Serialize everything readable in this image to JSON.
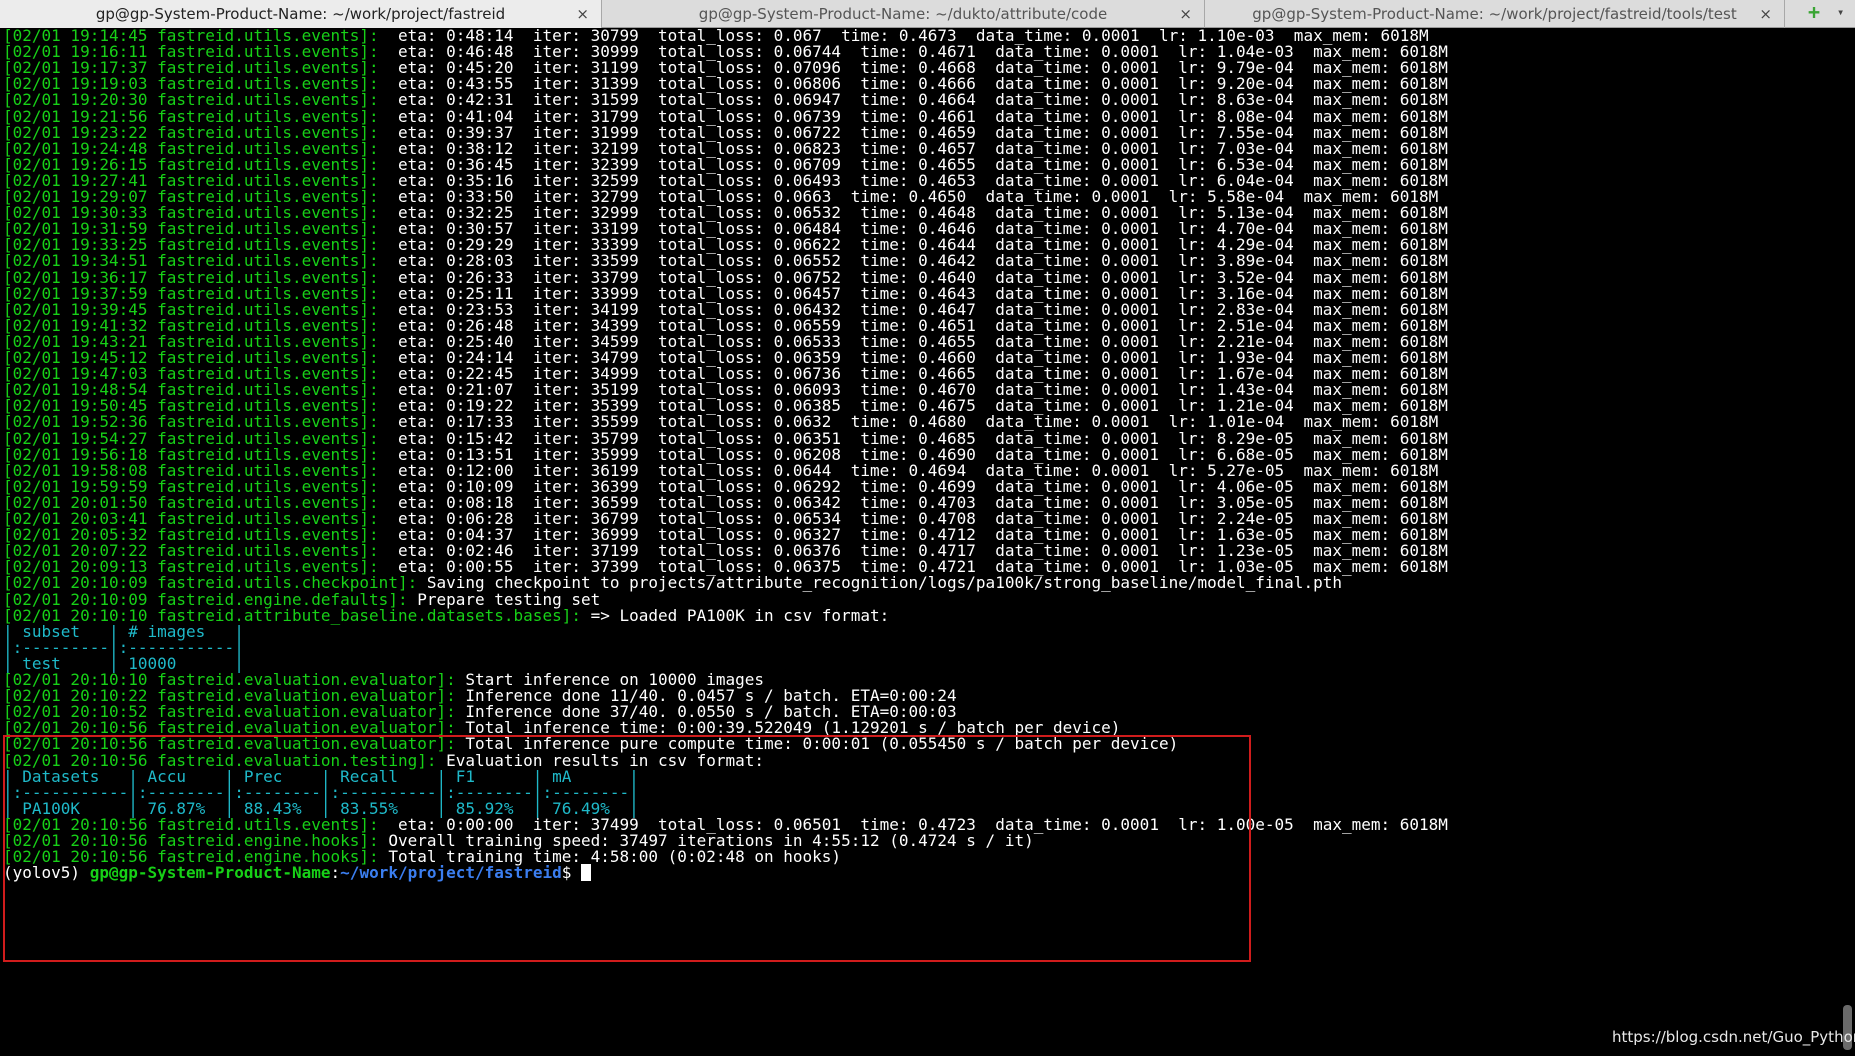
{
  "tabs": [
    {
      "title": "gp@gp-System-Product-Name: ~/work/project/fastreid",
      "active": true
    },
    {
      "title": "gp@gp-System-Product-Name: ~/dukto/attribute/code",
      "active": false
    },
    {
      "title": "gp@gp-System-Product-Name: ~/work/project/fastreid/tools/test",
      "active": false
    }
  ],
  "tab_close_symbol": "×",
  "new_tab_symbol": "+",
  "tab_menu_symbol": "▾",
  "colors": {
    "background": "#000000",
    "source_green": "#17d017",
    "table_cyan": "#1fb9c9",
    "highlight_red": "#d01c1c",
    "path_blue": "#3b7ef0"
  },
  "lines": [
    {
      "src": "[02/01 19:14:45 fastreid.utils.events]:",
      "msg": "  eta: 0:48:14  iter: 30799  total_loss: 0.067  time: 0.4673  data_time: 0.0001  lr: 1.10e-03  max_mem: 6018M"
    },
    {
      "src": "[02/01 19:16:11 fastreid.utils.events]:",
      "msg": "  eta: 0:46:48  iter: 30999  total_loss: 0.06744  time: 0.4671  data_time: 0.0001  lr: 1.04e-03  max_mem: 6018M"
    },
    {
      "src": "[02/01 19:17:37 fastreid.utils.events]:",
      "msg": "  eta: 0:45:20  iter: 31199  total_loss: 0.07096  time: 0.4668  data_time: 0.0001  lr: 9.79e-04  max_mem: 6018M"
    },
    {
      "src": "[02/01 19:19:03 fastreid.utils.events]:",
      "msg": "  eta: 0:43:55  iter: 31399  total_loss: 0.06806  time: 0.4666  data_time: 0.0001  lr: 9.20e-04  max_mem: 6018M"
    },
    {
      "src": "[02/01 19:20:30 fastreid.utils.events]:",
      "msg": "  eta: 0:42:31  iter: 31599  total_loss: 0.06947  time: 0.4664  data_time: 0.0001  lr: 8.63e-04  max_mem: 6018M"
    },
    {
      "src": "[02/01 19:21:56 fastreid.utils.events]:",
      "msg": "  eta: 0:41:04  iter: 31799  total_loss: 0.06739  time: 0.4661  data_time: 0.0001  lr: 8.08e-04  max_mem: 6018M"
    },
    {
      "src": "[02/01 19:23:22 fastreid.utils.events]:",
      "msg": "  eta: 0:39:37  iter: 31999  total_loss: 0.06722  time: 0.4659  data_time: 0.0001  lr: 7.55e-04  max_mem: 6018M"
    },
    {
      "src": "[02/01 19:24:48 fastreid.utils.events]:",
      "msg": "  eta: 0:38:12  iter: 32199  total_loss: 0.06823  time: 0.4657  data_time: 0.0001  lr: 7.03e-04  max_mem: 6018M"
    },
    {
      "src": "[02/01 19:26:15 fastreid.utils.events]:",
      "msg": "  eta: 0:36:45  iter: 32399  total_loss: 0.06709  time: 0.4655  data_time: 0.0001  lr: 6.53e-04  max_mem: 6018M"
    },
    {
      "src": "[02/01 19:27:41 fastreid.utils.events]:",
      "msg": "  eta: 0:35:16  iter: 32599  total_loss: 0.06493  time: 0.4653  data_time: 0.0001  lr: 6.04e-04  max_mem: 6018M"
    },
    {
      "src": "[02/01 19:29:07 fastreid.utils.events]:",
      "msg": "  eta: 0:33:50  iter: 32799  total_loss: 0.0663  time: 0.4650  data_time: 0.0001  lr: 5.58e-04  max_mem: 6018M"
    },
    {
      "src": "[02/01 19:30:33 fastreid.utils.events]:",
      "msg": "  eta: 0:32:25  iter: 32999  total_loss: 0.06532  time: 0.4648  data_time: 0.0001  lr: 5.13e-04  max_mem: 6018M"
    },
    {
      "src": "[02/01 19:31:59 fastreid.utils.events]:",
      "msg": "  eta: 0:30:57  iter: 33199  total_loss: 0.06484  time: 0.4646  data_time: 0.0001  lr: 4.70e-04  max_mem: 6018M"
    },
    {
      "src": "[02/01 19:33:25 fastreid.utils.events]:",
      "msg": "  eta: 0:29:29  iter: 33399  total_loss: 0.06622  time: 0.4644  data_time: 0.0001  lr: 4.29e-04  max_mem: 6018M"
    },
    {
      "src": "[02/01 19:34:51 fastreid.utils.events]:",
      "msg": "  eta: 0:28:03  iter: 33599  total_loss: 0.06552  time: 0.4642  data_time: 0.0001  lr: 3.89e-04  max_mem: 6018M"
    },
    {
      "src": "[02/01 19:36:17 fastreid.utils.events]:",
      "msg": "  eta: 0:26:33  iter: 33799  total_loss: 0.06752  time: 0.4640  data_time: 0.0001  lr: 3.52e-04  max_mem: 6018M"
    },
    {
      "src": "[02/01 19:37:59 fastreid.utils.events]:",
      "msg": "  eta: 0:25:11  iter: 33999  total_loss: 0.06457  time: 0.4643  data_time: 0.0001  lr: 3.16e-04  max_mem: 6018M"
    },
    {
      "src": "[02/01 19:39:45 fastreid.utils.events]:",
      "msg": "  eta: 0:23:53  iter: 34199  total_loss: 0.06432  time: 0.4647  data_time: 0.0001  lr: 2.83e-04  max_mem: 6018M"
    },
    {
      "src": "[02/01 19:41:32 fastreid.utils.events]:",
      "msg": "  eta: 0:26:48  iter: 34399  total_loss: 0.06559  time: 0.4651  data_time: 0.0001  lr: 2.51e-04  max_mem: 6018M"
    },
    {
      "src": "[02/01 19:43:21 fastreid.utils.events]:",
      "msg": "  eta: 0:25:40  iter: 34599  total_loss: 0.06533  time: 0.4655  data_time: 0.0001  lr: 2.21e-04  max_mem: 6018M"
    },
    {
      "src": "[02/01 19:45:12 fastreid.utils.events]:",
      "msg": "  eta: 0:24:14  iter: 34799  total_loss: 0.06359  time: 0.4660  data_time: 0.0001  lr: 1.93e-04  max_mem: 6018M"
    },
    {
      "src": "[02/01 19:47:03 fastreid.utils.events]:",
      "msg": "  eta: 0:22:45  iter: 34999  total_loss: 0.06736  time: 0.4665  data_time: 0.0001  lr: 1.67e-04  max_mem: 6018M"
    },
    {
      "src": "[02/01 19:48:54 fastreid.utils.events]:",
      "msg": "  eta: 0:21:07  iter: 35199  total_loss: 0.06093  time: 0.4670  data_time: 0.0001  lr: 1.43e-04  max_mem: 6018M"
    },
    {
      "src": "[02/01 19:50:45 fastreid.utils.events]:",
      "msg": "  eta: 0:19:22  iter: 35399  total_loss: 0.06385  time: 0.4675  data_time: 0.0001  lr: 1.21e-04  max_mem: 6018M"
    },
    {
      "src": "[02/01 19:52:36 fastreid.utils.events]:",
      "msg": "  eta: 0:17:33  iter: 35599  total_loss: 0.0632  time: 0.4680  data_time: 0.0001  lr: 1.01e-04  max_mem: 6018M"
    },
    {
      "src": "[02/01 19:54:27 fastreid.utils.events]:",
      "msg": "  eta: 0:15:42  iter: 35799  total_loss: 0.06351  time: 0.4685  data_time: 0.0001  lr: 8.29e-05  max_mem: 6018M"
    },
    {
      "src": "[02/01 19:56:18 fastreid.utils.events]:",
      "msg": "  eta: 0:13:51  iter: 35999  total_loss: 0.06208  time: 0.4690  data_time: 0.0001  lr: 6.68e-05  max_mem: 6018M"
    },
    {
      "src": "[02/01 19:58:08 fastreid.utils.events]:",
      "msg": "  eta: 0:12:00  iter: 36199  total_loss: 0.0644  time: 0.4694  data_time: 0.0001  lr: 5.27e-05  max_mem: 6018M"
    },
    {
      "src": "[02/01 19:59:59 fastreid.utils.events]:",
      "msg": "  eta: 0:10:09  iter: 36399  total_loss: 0.06292  time: 0.4699  data_time: 0.0001  lr: 4.06e-05  max_mem: 6018M"
    },
    {
      "src": "[02/01 20:01:50 fastreid.utils.events]:",
      "msg": "  eta: 0:08:18  iter: 36599  total_loss: 0.06342  time: 0.4703  data_time: 0.0001  lr: 3.05e-05  max_mem: 6018M"
    },
    {
      "src": "[02/01 20:03:41 fastreid.utils.events]:",
      "msg": "  eta: 0:06:28  iter: 36799  total_loss: 0.06534  time: 0.4708  data_time: 0.0001  lr: 2.24e-05  max_mem: 6018M"
    },
    {
      "src": "[02/01 20:05:32 fastreid.utils.events]:",
      "msg": "  eta: 0:04:37  iter: 36999  total_loss: 0.06327  time: 0.4712  data_time: 0.0001  lr: 1.63e-05  max_mem: 6018M"
    },
    {
      "src": "[02/01 20:07:22 fastreid.utils.events]:",
      "msg": "  eta: 0:02:46  iter: 37199  total_loss: 0.06376  time: 0.4717  data_time: 0.0001  lr: 1.23e-05  max_mem: 6018M"
    },
    {
      "src": "[02/01 20:09:13 fastreid.utils.events]:",
      "msg": "  eta: 0:00:55  iter: 37399  total_loss: 0.06375  time: 0.4721  data_time: 0.0001  lr: 1.03e-05  max_mem: 6018M"
    },
    {
      "src": "[02/01 20:10:09 fastreid.utils.checkpoint]:",
      "msg": " Saving checkpoint to projects/attribute_recognition/logs/pa100k/strong_baseline/model_final.pth"
    },
    {
      "src": "[02/01 20:10:09 fastreid.engine.defaults]:",
      "msg": " Prepare testing set"
    },
    {
      "src": "[02/01 20:10:10 fastreid.attribute_baseline.datasets.bases]:",
      "msg": " => Loaded PA100K in csv format:"
    },
    {
      "table": "| subset   | # images   |"
    },
    {
      "table": "|:---------|:-----------|"
    },
    {
      "table": "| test     | 10000      |"
    },
    {
      "src": "[02/01 20:10:10 fastreid.evaluation.evaluator]:",
      "msg": " Start inference on 10000 images"
    },
    {
      "src": "[02/01 20:10:22 fastreid.evaluation.evaluator]:",
      "msg": " Inference done 11/40. 0.0457 s / batch. ETA=0:00:24"
    },
    {
      "src": "[02/01 20:10:52 fastreid.evaluation.evaluator]:",
      "msg": " Inference done 37/40. 0.0550 s / batch. ETA=0:00:03"
    },
    {
      "src": "[02/01 20:10:56 fastreid.evaluation.evaluator]:",
      "msg": " Total inference time: 0:00:39.522049 (1.129201 s / batch per device)"
    },
    {
      "src": "[02/01 20:10:56 fastreid.evaluation.evaluator]:",
      "msg": " Total inference pure compute time: 0:00:01 (0.055450 s / batch per device)"
    },
    {
      "src": "[02/01 20:10:56 fastreid.evaluation.testing]:",
      "msg": " Evaluation results in csv format:"
    },
    {
      "table": "| Datasets   | Accu    | Prec    | Recall    | F1      | mA      |"
    },
    {
      "table": "|:-----------|:--------|:--------|:----------|:--------|:--------|"
    },
    {
      "table": "| PA100K     | 76.87%  | 88.43%  | 83.55%    | 85.92%  | 76.49%  |"
    },
    {
      "src": "[02/01 20:10:56 fastreid.utils.events]:",
      "msg": "  eta: 0:00:00  iter: 37499  total_loss: 0.06501  time: 0.4723  data_time: 0.0001  lr: 1.00e-05  max_mem: 6018M"
    },
    {
      "src": "[02/01 20:10:56 fastreid.engine.hooks]:",
      "msg": " Overall training speed: 37497 iterations in 4:55:12 (0.4724 s / it)"
    },
    {
      "src": "[02/01 20:10:56 fastreid.engine.hooks]:",
      "msg": " Total training time: 4:58:00 (0:02:48 on hooks)"
    }
  ],
  "prompt": {
    "env": "(yolov5) ",
    "user_host": "gp@gp-System-Product-Name",
    "sep": ":",
    "path": "~/work/project/fastreid",
    "symbol": "$ "
  },
  "watermark": "https://blog.csdn.net/Guo_Python"
}
